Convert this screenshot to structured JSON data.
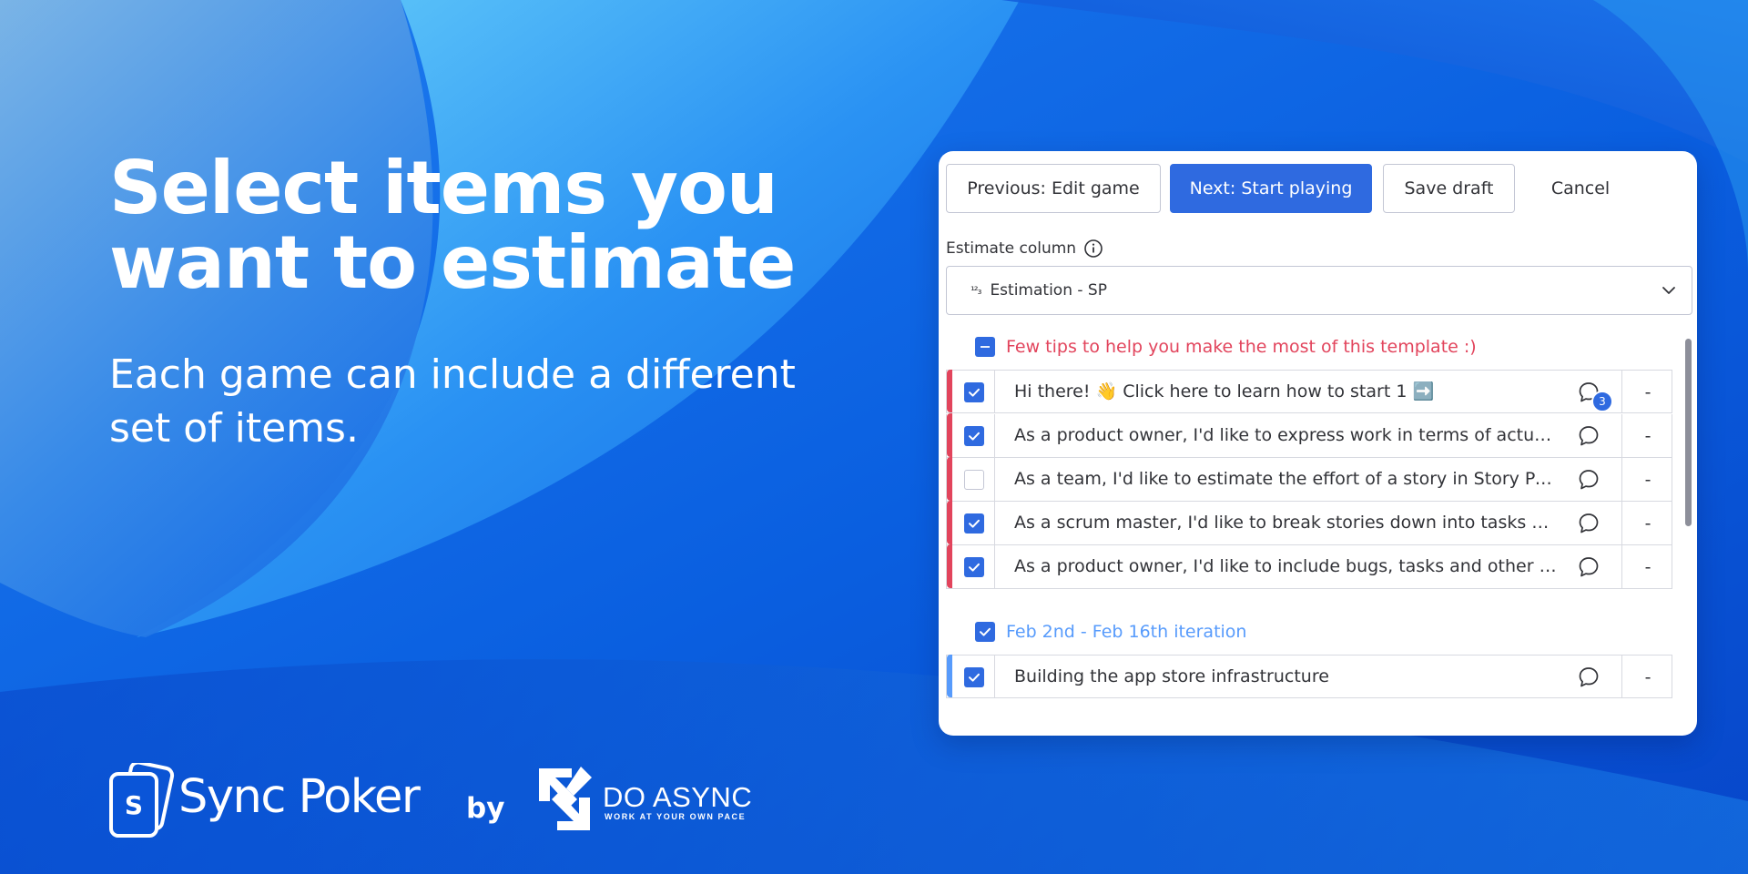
{
  "hero": {
    "title": "Select items you want to estimate",
    "subtitle": "Each game can include a different set of items."
  },
  "brand": {
    "logo_letter": "S",
    "name": "Sync Poker",
    "by": "by",
    "partner_name": "DO ASYNC",
    "partner_tagline": "WORK AT YOUR OWN PACE"
  },
  "toolbar": {
    "previous_label": "Previous: Edit game",
    "next_label": "Next: Start playing",
    "save_label": "Save draft",
    "cancel_label": "Cancel"
  },
  "estimate": {
    "label": "Estimate column",
    "icon": "info-icon",
    "selected_icon_text": "¹²₃",
    "selected_value": "Estimation - SP"
  },
  "groups": [
    {
      "title": "Few tips to help you make the most of this template :)",
      "color": "#e2445c",
      "state": "partial",
      "items": [
        {
          "name": "Hi there! 👋 Click here to learn how to start 1 ➡️",
          "checked": true,
          "comments": "3",
          "estimate": "-"
        },
        {
          "name": "As a product owner, I'd like to express work in terms of actual user problems",
          "checked": true,
          "comments": "",
          "estimate": "-"
        },
        {
          "name": "As a team, I'd like to estimate the effort of a story in Story Points",
          "checked": false,
          "comments": "",
          "estimate": "-"
        },
        {
          "name": "As a scrum master, I'd like to break stories down into tasks we can track",
          "checked": true,
          "comments": "",
          "estimate": "-"
        },
        {
          "name": "As a product owner, I'd like to include bugs, tasks and other work items",
          "checked": true,
          "comments": "",
          "estimate": "-"
        }
      ]
    },
    {
      "title": "Feb 2nd - Feb 16th iteration",
      "color": "#579bfc",
      "state": "checked",
      "items": [
        {
          "name": "Building the app store infrastructure",
          "checked": true,
          "comments": "",
          "estimate": "-"
        }
      ]
    }
  ],
  "colors": {
    "primary": "#2f6ae0",
    "bg_blue": "#0a55d8",
    "group1": "#e2445c",
    "group2": "#579bfc"
  }
}
